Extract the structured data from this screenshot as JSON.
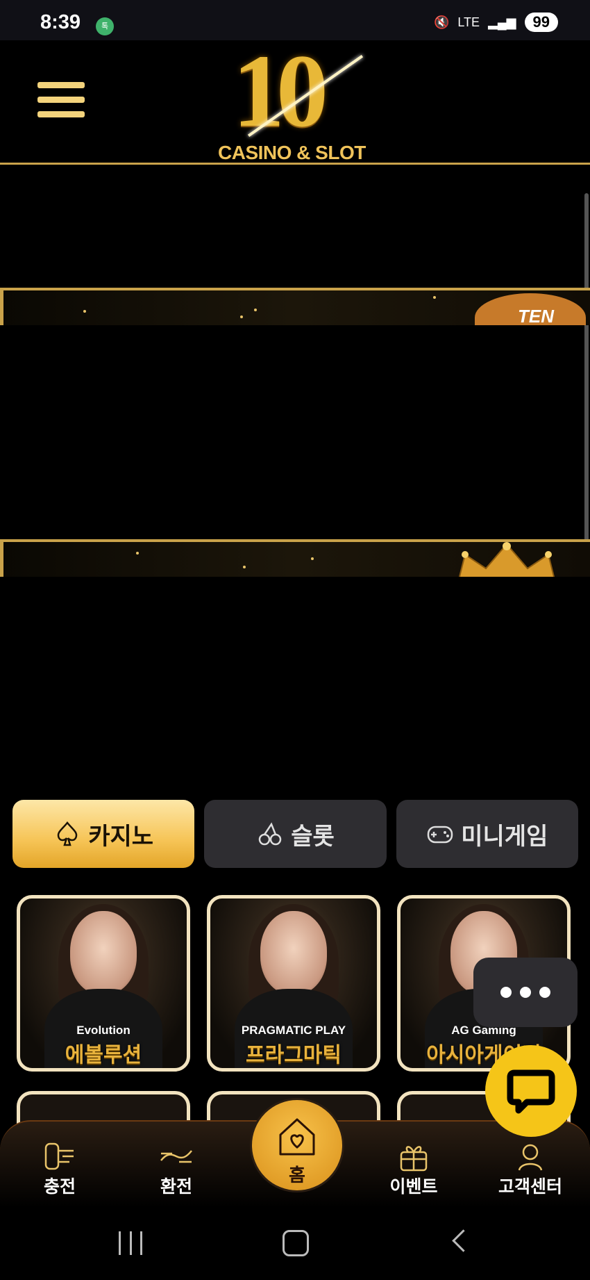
{
  "status_bar": {
    "time": "8:39",
    "app_badge": "톡",
    "network": "LTE",
    "battery": "99"
  },
  "header": {
    "logo_number": "10",
    "logo_text": "CASINO & SLOT",
    "menu_icon": "hamburger-icon"
  },
  "banners": [
    {
      "badge_text": "TEN",
      "decoration": "bear"
    },
    {
      "badge_text": "",
      "decoration": "crown"
    }
  ],
  "tabs": [
    {
      "label": "카지노",
      "icon": "spade-icon",
      "active": true
    },
    {
      "label": "슬롯",
      "icon": "cherry-icon",
      "active": false
    },
    {
      "label": "미니게임",
      "icon": "gamepad-icon",
      "active": false
    }
  ],
  "game_cards": [
    {
      "brand": "Evolution",
      "label": "에볼루션"
    },
    {
      "brand": "PRAGMATIC PLAY",
      "label": "프라그마틱"
    },
    {
      "brand": "AG Gaming",
      "label": "아시아게이밍"
    }
  ],
  "floating": {
    "more_icon": "ellipsis-icon",
    "chat_icon": "chat-bubble-icon"
  },
  "bottom_nav": {
    "items": [
      {
        "label": "충전",
        "icon": "deposit-icon"
      },
      {
        "label": "환전",
        "icon": "withdraw-icon"
      },
      {
        "label": "홈",
        "icon": "home-heart-icon"
      },
      {
        "label": "이벤트",
        "icon": "gift-icon"
      },
      {
        "label": "고객센터",
        "icon": "support-icon"
      }
    ]
  },
  "colors": {
    "gold": "#f6c456",
    "background": "#000000",
    "tab_inactive": "#2e2d31",
    "chat_button": "#f5c518"
  }
}
